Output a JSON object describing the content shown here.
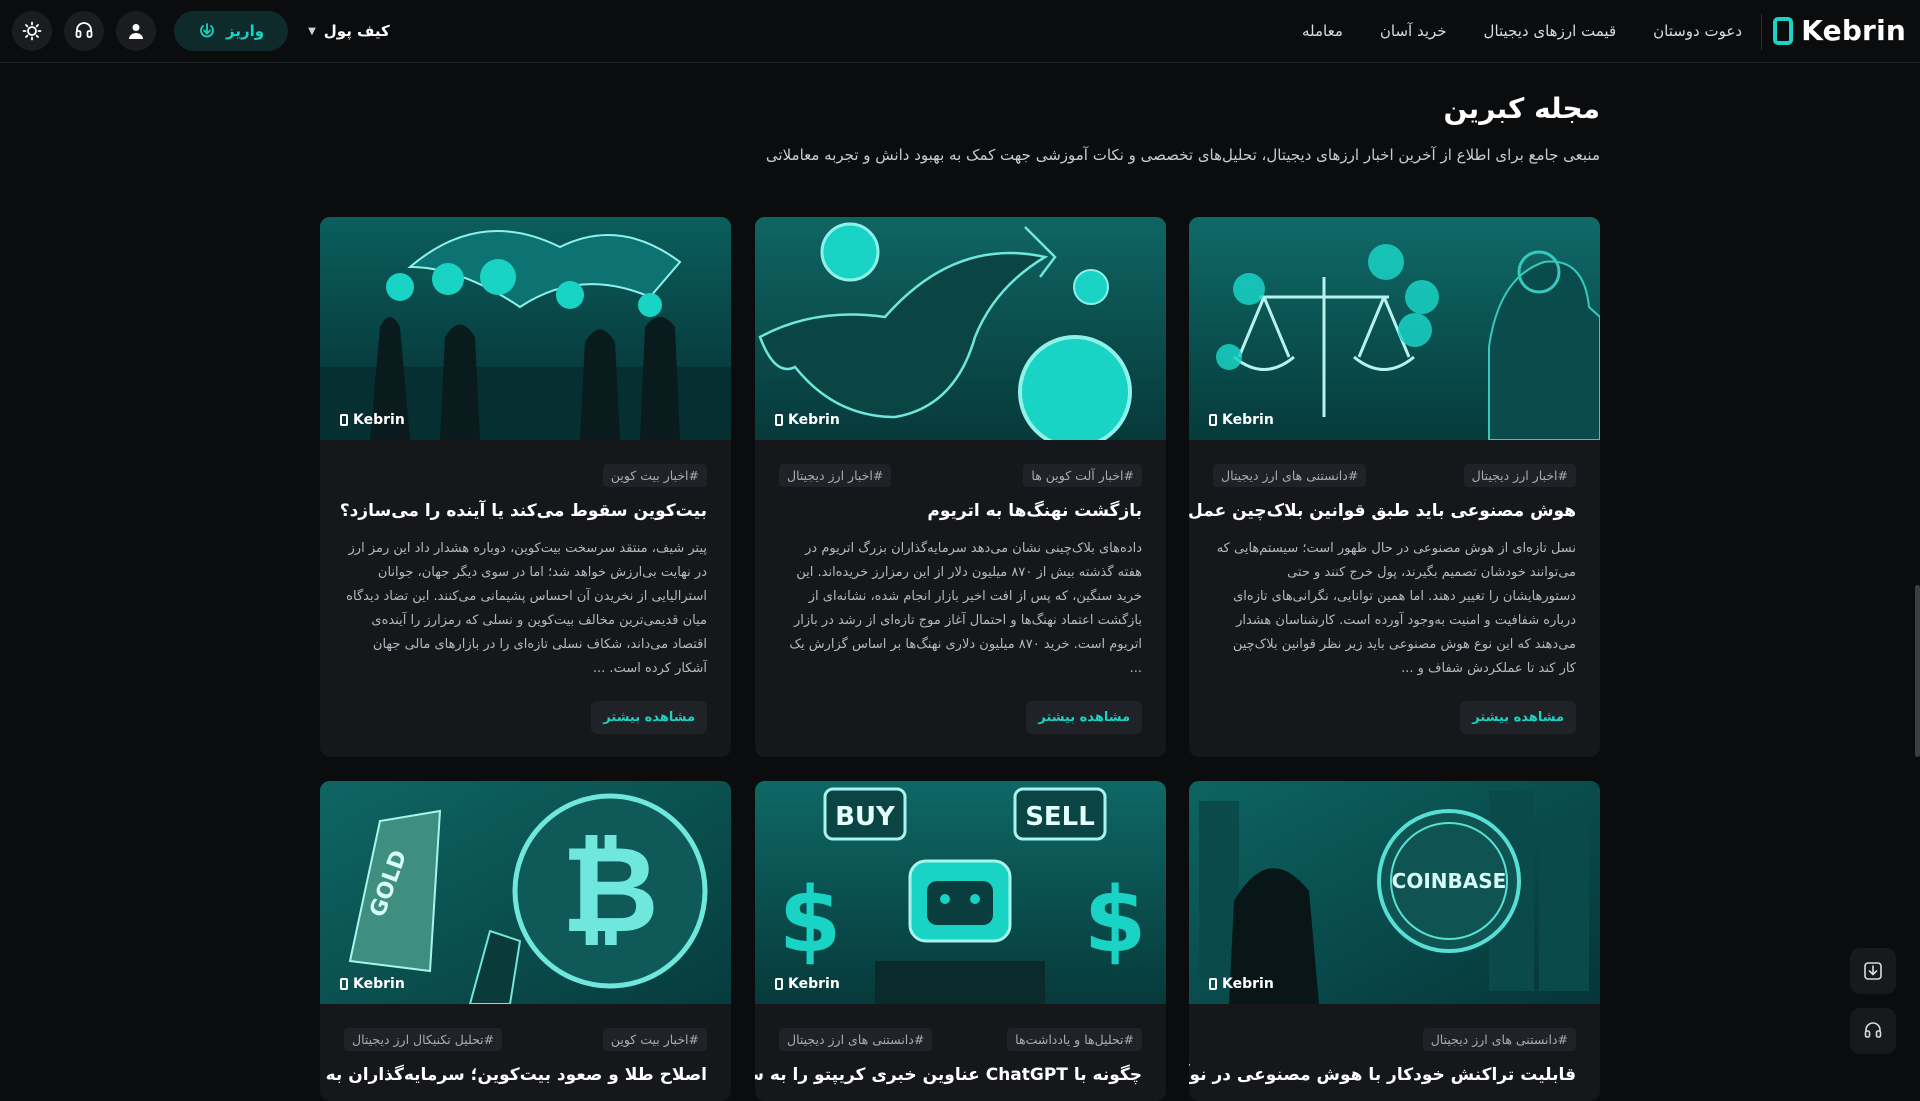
{
  "brand": {
    "name": "Kebrin"
  },
  "nav": {
    "items": [
      {
        "label": "معامله"
      },
      {
        "label": "خرید آسان"
      },
      {
        "label": "قیمت ارزهای دیجیتال"
      },
      {
        "label": "دعوت دوستان"
      }
    ]
  },
  "header": {
    "wallet_label": "کیف پول",
    "deposit_label": "واریز",
    "icons": [
      "user-icon",
      "headset-icon",
      "sun-icon",
      "caret-down-icon",
      "download-icon"
    ]
  },
  "page": {
    "title": "مجله کبرین",
    "subtitle": "منبعی جامع برای اطلاع از آخرین اخبار ارزهای دیجیتال، تحلیل‌های تخصصی و نکات آموزشی جهت کمک به بهبود دانش و تجربه معاملاتی"
  },
  "articles": [
    {
      "tags": [
        "#اخبار ارز دیجیتال",
        "#دانستنی های ارز دیجیتال"
      ],
      "title": "هوش مصنوعی باید طبق قوانین بلاک‌چین عمل کند",
      "excerpt": "نسل تازه‌ای از هوش مصنوعی در حال ظهور است؛ سیستم‌هایی که می‌توانند خودشان تصمیم بگیرند، پول خرج کنند و حتی دستورهایشان را تغییر دهند. اما همین توانایی، نگرانی‌های تازه‌ای درباره شفافیت و امنیت به‌وجود آورده است. کارشناسان هشدار می‌دهند که این نوع هوش مصنوعی باید زیر نظر قوانین بلاک‌چین کار کند تا عملکردش شفاف و ...",
      "more": "مشاهده بیشتر",
      "image_brand": "Kebrin"
    },
    {
      "tags": [
        "#اخبار آلت کوین ها",
        "#اخبار ارز دیجیتال"
      ],
      "title": "بازگشت نهنگ‌ها به اتریوم",
      "excerpt": "داده‌های بلاک‌چینی نشان می‌دهد سرمایه‌گذاران بزرگ اتریوم در هفته گذشته بیش از ۸۷۰ میلیون دلار از این رمزارز خریده‌اند. این خرید سنگین، که پس از افت اخیر بازار انجام شده، نشانه‌ای از بازگشت اعتماد نهنگ‌ها و احتمال آغاز موج تازه‌ای از رشد در بازار اتریوم است. خرید ۸۷۰ میلیون دلاری نهنگ‌ها بر اساس گزارش یک ...",
      "more": "مشاهده بیشتر",
      "image_brand": "Kebrin"
    },
    {
      "tags": [
        "#اخبار بیت کوین"
      ],
      "title": "بیت‌کوین سقوط می‌کند یا آینده را می‌سازد؟",
      "excerpt": "پیتر شیف، منتقد سرسخت بیت‌کوین، دوباره هشدار داد این رمز ارز در نهایت بی‌ارزش خواهد شد؛ اما در سوی دیگر جهان، جوانان استرالیایی از نخریدن آن احساس پشیمانی می‌کنند. این تضاد دیدگاه میان قدیمی‌ترین مخالف بیت‌کوین و نسلی که رمزارز را آینده‌ی اقتصاد می‌داند، شکاف نسلی تازه‌ای را در بازارهای مالی جهان آشکار کرده است. ...",
      "more": "مشاهده بیشتر",
      "image_brand": "Kebrin"
    },
    {
      "tags": [
        "#دانستنی های ارز دیجیتال"
      ],
      "title": "قابلیت تراکنش خودکار با هوش مصنوعی در نوآوری",
      "image_brand": "Kebrin",
      "image_text": "COINBASE"
    },
    {
      "tags": [
        "#تحلیل‌ها و یادداشت‌ها",
        "#دانستنی های ارز دیجیتال"
      ],
      "title": "چگونه با ChatGPT عناوین خبری کریپتو را به سیگنال",
      "image_brand": "Kebrin",
      "image_buy": "BUY",
      "image_sell": "SELL"
    },
    {
      "tags": [
        "#اخبار بیت کوین",
        "#تحلیل تکنیکال ارز دیجیتال"
      ],
      "title": "اصلاح طلا و صعود بیت‌کوین؛ سرمایه‌گذاران به کدام",
      "image_brand": "Kebrin",
      "image_gold": "GOLD"
    }
  ],
  "colors": {
    "accent": "#19d3c5",
    "background": "#0b0c0e",
    "card": "#15171b"
  }
}
